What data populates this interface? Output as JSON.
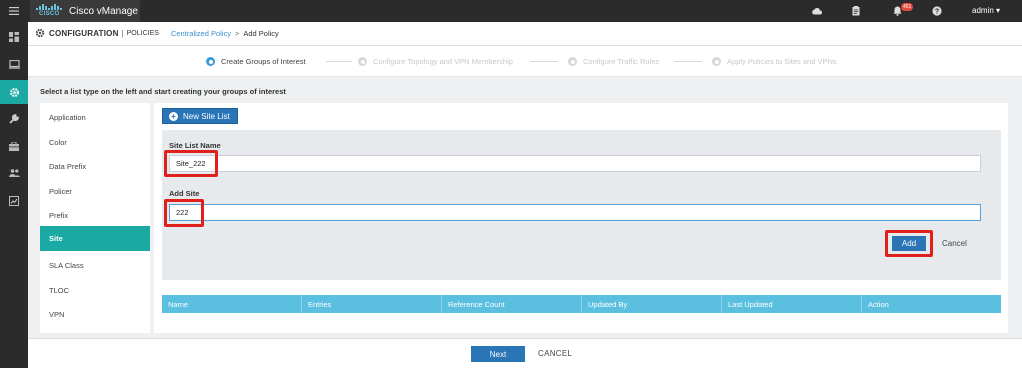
{
  "app": {
    "title": "Cisco vManage",
    "logo_text": "CISCO",
    "notification_count": "451",
    "user": "admin ▾"
  },
  "topbar": {
    "icons": [
      "cloud-icon",
      "clipboard-icon",
      "bell-icon",
      "help-icon"
    ]
  },
  "leftnav": {
    "items": [
      "dashboard-icon",
      "monitor-icon",
      "configuration-icon",
      "tools-icon",
      "maintenance-icon",
      "administration-icon",
      "analytics-icon"
    ],
    "active": "configuration-icon"
  },
  "breadcrumb": {
    "section": "CONFIGURATION",
    "separator": "|",
    "subsection": "POLICIES",
    "link": "Centralized Policy",
    "arrow": ">",
    "current": "Add Policy"
  },
  "stepper": {
    "steps": [
      {
        "label": "Create Groups of Interest",
        "active": true
      },
      {
        "label": "Configure Topology and VPN Membership",
        "active": false
      },
      {
        "label": "Configure Traffic Rules",
        "active": false
      },
      {
        "label": "Apply Policies to Sites and VPNs",
        "active": false
      }
    ]
  },
  "instruction": "Select a list type on the left and start creating your groups of interest",
  "list_types": {
    "items": [
      "Application",
      "Color",
      "Data Prefix",
      "Policer",
      "Prefix",
      "Site",
      "SLA Class",
      "TLOC",
      "VPN"
    ],
    "active": "Site"
  },
  "main": {
    "new_button": "New Site List",
    "site_list_name_label": "Site List Name",
    "site_list_name_value": "Site_222",
    "add_site_label": "Add Site",
    "add_site_value": "222",
    "add_button": "Add",
    "cancel_link": "Cancel"
  },
  "table": {
    "columns": [
      "Name",
      "Entries",
      "Reference Count",
      "Updated By",
      "Last Updated",
      "Action"
    ]
  },
  "footer": {
    "next_button": "Next",
    "cancel_button": "CANCEL"
  },
  "colors": {
    "teal": "#1ba9a3",
    "blue_button": "#2a75b6",
    "table_header": "#5bbfe0",
    "highlight_red": "#e0201c",
    "topbar": "#2b2b2b"
  }
}
